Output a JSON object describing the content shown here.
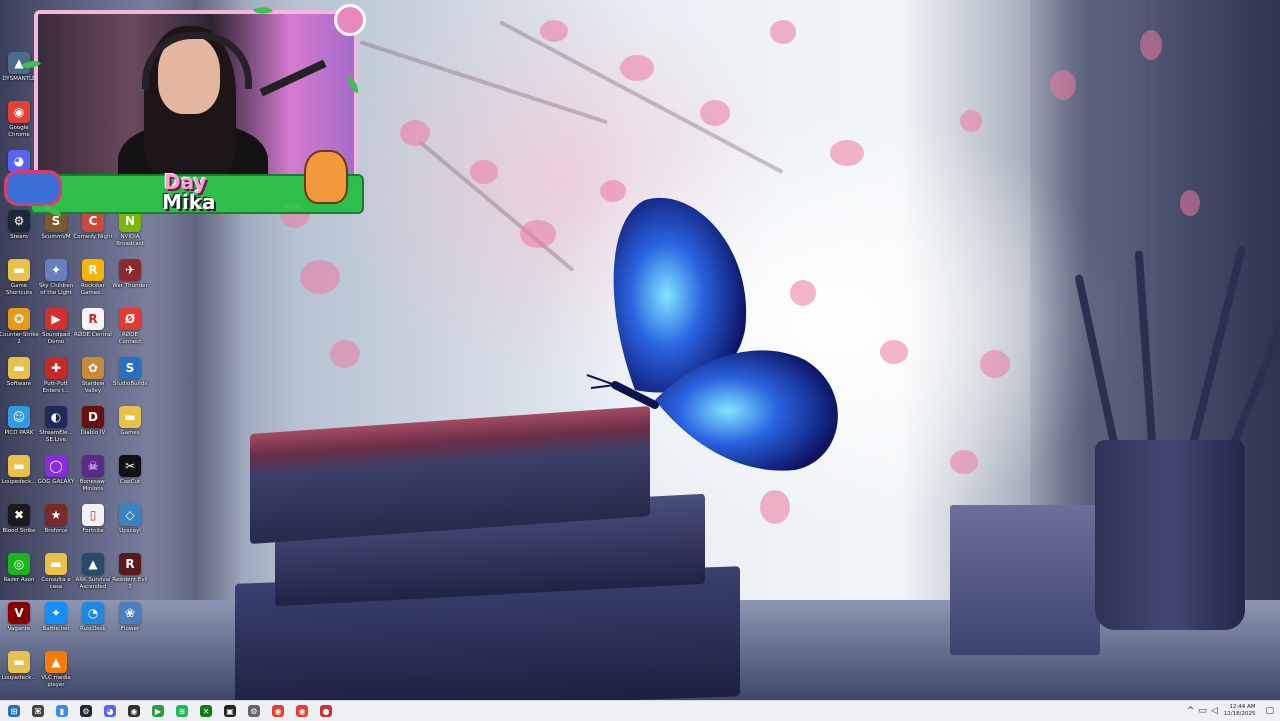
{
  "desktop": {
    "icons": [
      {
        "label": "DYSMANTLE",
        "glyph": "▲",
        "color": "#4a6b8a"
      },
      {
        "label": "Google Chrome",
        "glyph": "◉",
        "color": "#e34133"
      },
      {
        "label": "Discord",
        "glyph": "◕",
        "color": "#5865f2"
      },
      {
        "label": "Steam",
        "glyph": "⚙",
        "color": "#1b2838"
      },
      {
        "label": "ScummVM",
        "glyph": "S",
        "color": "#7a5a2a"
      },
      {
        "label": "Comedy Night",
        "glyph": "C",
        "color": "#c94a3a"
      },
      {
        "label": "NVIDIA Broadcast",
        "glyph": "N",
        "color": "#76b900"
      },
      {
        "label": "Game Shortcuts",
        "glyph": "▬",
        "color": "#e8c14a"
      },
      {
        "label": "Sky Children of the Light",
        "glyph": "✦",
        "color": "#6b7fbf"
      },
      {
        "label": "Rockstar Games...",
        "glyph": "R",
        "color": "#f4b400"
      },
      {
        "label": "War Thunder",
        "glyph": "✈",
        "color": "#8a2a2a"
      },
      {
        "label": "Counter-Strike 2",
        "glyph": "✪",
        "color": "#e59a1a"
      },
      {
        "label": "Soundpad Demo",
        "glyph": "▶",
        "color": "#d32f2f"
      },
      {
        "label": "RØDE Central",
        "glyph": "R",
        "color": "#f5f5f5"
      },
      {
        "label": "RØDE Connect",
        "glyph": "Ø",
        "color": "#e53935"
      },
      {
        "label": "Software",
        "glyph": "▬",
        "color": "#e8c14a"
      },
      {
        "label": "Putt-Putt Enters t...",
        "glyph": "✚",
        "color": "#c62828"
      },
      {
        "label": "Stardew Valley",
        "glyph": "✿",
        "color": "#c98a3a"
      },
      {
        "label": "StudioBuilds",
        "glyph": "S",
        "color": "#2a6fbf"
      },
      {
        "label": "PICO PARK",
        "glyph": "☺",
        "color": "#2f9be5"
      },
      {
        "label": "StreamEle... SE.Live",
        "glyph": "◐",
        "color": "#1d2a5a"
      },
      {
        "label": "Diablo IV",
        "glyph": "D",
        "color": "#6a0f0f"
      },
      {
        "label": "Games",
        "glyph": "▬",
        "color": "#e8c14a"
      },
      {
        "label": "Loupedeck...",
        "glyph": "▬",
        "color": "#e8c14a"
      },
      {
        "label": "GOG GALAXY",
        "glyph": "◯",
        "color": "#8a2be2"
      },
      {
        "label": "Bonesaw: Minions",
        "glyph": "☠",
        "color": "#5a2a8a"
      },
      {
        "label": "CapCut",
        "glyph": "✂",
        "color": "#111111"
      },
      {
        "label": "Blood Strike",
        "glyph": "✖",
        "color": "#1a1a1a"
      },
      {
        "label": "Broforce",
        "glyph": "★",
        "color": "#7a2a2a"
      },
      {
        "label": "Fortnite",
        "glyph": "▯",
        "color": "#f2f2f2"
      },
      {
        "label": "Upscayl",
        "glyph": "◇",
        "color": "#3b82c4"
      },
      {
        "label": "Razer Axon",
        "glyph": "◎",
        "color": "#1bb51b"
      },
      {
        "label": "Consulta e casa",
        "glyph": "▬",
        "color": "#e8c14a"
      },
      {
        "label": "ARK Survival Ascended",
        "glyph": "▲",
        "color": "#2a4a6a"
      },
      {
        "label": "Resident Evil 3",
        "glyph": "R",
        "color": "#5a1a1a"
      },
      {
        "label": "Vagante",
        "glyph": "V",
        "color": "#8b0000"
      },
      {
        "label": "Battle.net",
        "glyph": "✦",
        "color": "#148eff"
      },
      {
        "label": "RustDesk",
        "glyph": "◔",
        "color": "#1e88e5"
      },
      {
        "label": "Flower",
        "glyph": "❀",
        "color": "#4b7fbf"
      },
      {
        "label": "Loupedeck...",
        "glyph": "▬",
        "color": "#e8c14a"
      },
      {
        "label": "VLC media player",
        "glyph": "▲",
        "color": "#f57c00"
      }
    ]
  },
  "webcam": {
    "brand_line1": "Day",
    "brand_line2": "Mika"
  },
  "taskbar": {
    "apps": [
      {
        "name": "start",
        "glyph": "⊞",
        "color": "#1f6fd1"
      },
      {
        "name": "terminal",
        "glyph": "⌘",
        "color": "#444444"
      },
      {
        "name": "file-explorer",
        "glyph": "▮",
        "color": "#3a8ee6"
      },
      {
        "name": "steam",
        "glyph": "⚙",
        "color": "#1b2838"
      },
      {
        "name": "discord",
        "glyph": "◕",
        "color": "#5865f2"
      },
      {
        "name": "obs",
        "glyph": "◉",
        "color": "#303030"
      },
      {
        "name": "app-green-play",
        "glyph": "▶",
        "color": "#2a9d3a"
      },
      {
        "name": "spotify",
        "glyph": "≋",
        "color": "#1db954"
      },
      {
        "name": "xbox",
        "glyph": "✕",
        "color": "#107c10"
      },
      {
        "name": "app-square",
        "glyph": "▣",
        "color": "#222222"
      },
      {
        "name": "app-settings",
        "glyph": "⚙",
        "color": "#666666"
      },
      {
        "name": "chrome",
        "glyph": "◉",
        "color": "#e34133"
      },
      {
        "name": "chrome-2",
        "glyph": "◉",
        "color": "#e34133"
      },
      {
        "name": "app-red",
        "glyph": "●",
        "color": "#d32f2f"
      }
    ],
    "tray": {
      "chevron": "^",
      "network": "▭",
      "volume": "◁",
      "time": "12:44 AM",
      "date": "12/18/2025",
      "notification": "▢"
    }
  }
}
